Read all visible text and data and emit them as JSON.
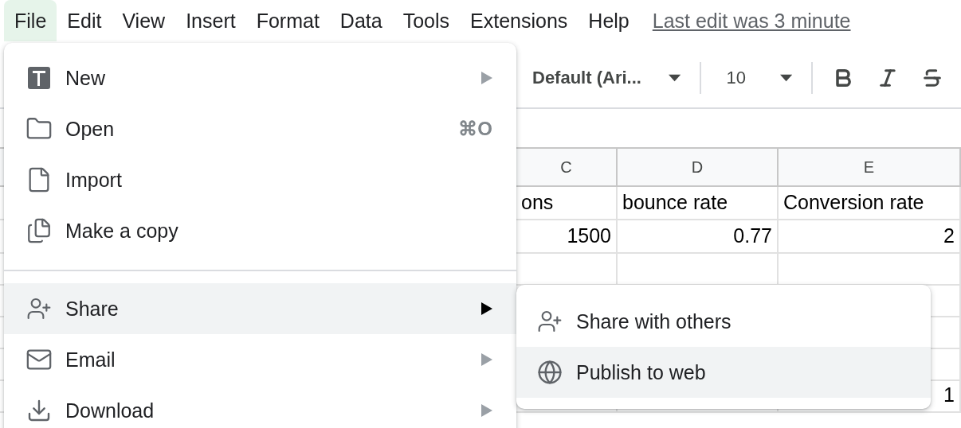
{
  "menubar": {
    "items": [
      {
        "label": "File",
        "selected": true
      },
      {
        "label": "Edit",
        "selected": false
      },
      {
        "label": "View",
        "selected": false
      },
      {
        "label": "Insert",
        "selected": false
      },
      {
        "label": "Format",
        "selected": false
      },
      {
        "label": "Data",
        "selected": false
      },
      {
        "label": "Tools",
        "selected": false
      },
      {
        "label": "Extensions",
        "selected": false
      },
      {
        "label": "Help",
        "selected": false
      }
    ],
    "last_edit": "Last edit was 3 minute"
  },
  "toolbar": {
    "font": "Default (Ari...",
    "font_size": "10"
  },
  "sheet": {
    "columns": [
      "C",
      "D",
      "E"
    ],
    "rows": [
      {
        "kind": "text",
        "cells": [
          "ons",
          "bounce rate",
          "Conversion rate"
        ]
      },
      {
        "kind": "number",
        "cells": [
          "1500",
          "0.77",
          "2"
        ]
      },
      {
        "kind": "number",
        "cells": [
          null,
          null,
          null
        ]
      },
      {
        "kind": "number",
        "cells": [
          null,
          null,
          null
        ]
      },
      {
        "kind": "number",
        "cells": [
          null,
          null,
          null
        ]
      },
      {
        "kind": "number",
        "cells": [
          null,
          null,
          null
        ]
      },
      {
        "kind": "number",
        "cells": [
          null,
          null,
          "1"
        ]
      }
    ]
  },
  "file_menu": {
    "items": [
      {
        "label": "New",
        "submenu": true,
        "highlighted": false
      },
      {
        "label": "Open",
        "shortcut": "⌘O",
        "submenu": false,
        "highlighted": false
      },
      {
        "label": "Import",
        "submenu": false,
        "highlighted": false
      },
      {
        "label": "Make a copy",
        "submenu": false,
        "highlighted": false,
        "divider_after": true
      },
      {
        "label": "Share",
        "submenu": true,
        "highlighted": true
      },
      {
        "label": "Email",
        "submenu": true,
        "highlighted": false
      },
      {
        "label": "Download",
        "submenu": true,
        "highlighted": false
      }
    ]
  },
  "share_submenu": {
    "items": [
      {
        "label": "Share with others",
        "highlighted": false
      },
      {
        "label": "Publish to web",
        "highlighted": true
      }
    ]
  }
}
